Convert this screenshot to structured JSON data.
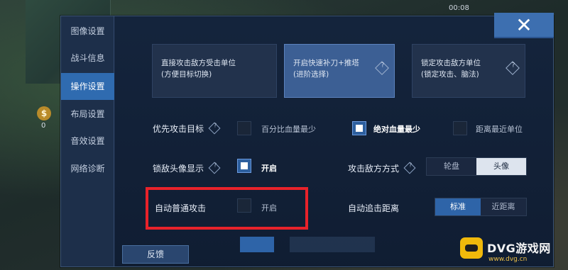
{
  "status": {
    "time": "00:08"
  },
  "side": {
    "coin_icon": "$",
    "coin_value": "0"
  },
  "sidebar": {
    "items": [
      {
        "label": "图像设置"
      },
      {
        "label": "战斗信息"
      },
      {
        "label": "操作设置",
        "active": true
      },
      {
        "label": "布局设置"
      },
      {
        "label": "音效设置"
      },
      {
        "label": "网络诊断"
      }
    ]
  },
  "close": {
    "icon": "close-icon",
    "glyph": "✕"
  },
  "mode_cards": [
    {
      "line1": "直接攻击敌方受击单位",
      "line2": "(方便目标切换)",
      "selected": false
    },
    {
      "line1": "开启快速补刀+推塔",
      "line2": "(进阶选择)",
      "selected": true
    },
    {
      "line1": "锁定攻击敌方单位",
      "line2": "(锁定攻击、脑法)",
      "selected": false
    }
  ],
  "settings": {
    "priority_target": {
      "label": "优先攻击目标",
      "options": [
        {
          "label": "百分比血量最少",
          "checked": false
        },
        {
          "label": "绝对血量最少",
          "checked": true
        },
        {
          "label": "距离最近单位",
          "checked": false
        }
      ]
    },
    "lock_avatar": {
      "label": "锁敌头像显示",
      "option": "开启",
      "checked": true
    },
    "attack_mode": {
      "label": "攻击敌方方式",
      "options": [
        "轮盘",
        "头像"
      ],
      "selected": "头像"
    },
    "auto_attack": {
      "label": "自动普通攻击",
      "option": "开启",
      "checked": false
    },
    "auto_chase": {
      "label": "自动追击距离",
      "options": [
        "标准",
        "近距离"
      ],
      "selected": "标准"
    }
  },
  "feedback_button": "反馈",
  "colors": {
    "accent": "#2f6bb0",
    "highlight": "#e8222a",
    "panel": "#162640"
  },
  "watermark": {
    "brand": "DVG游戏网",
    "url": "www.dvg.cn"
  }
}
